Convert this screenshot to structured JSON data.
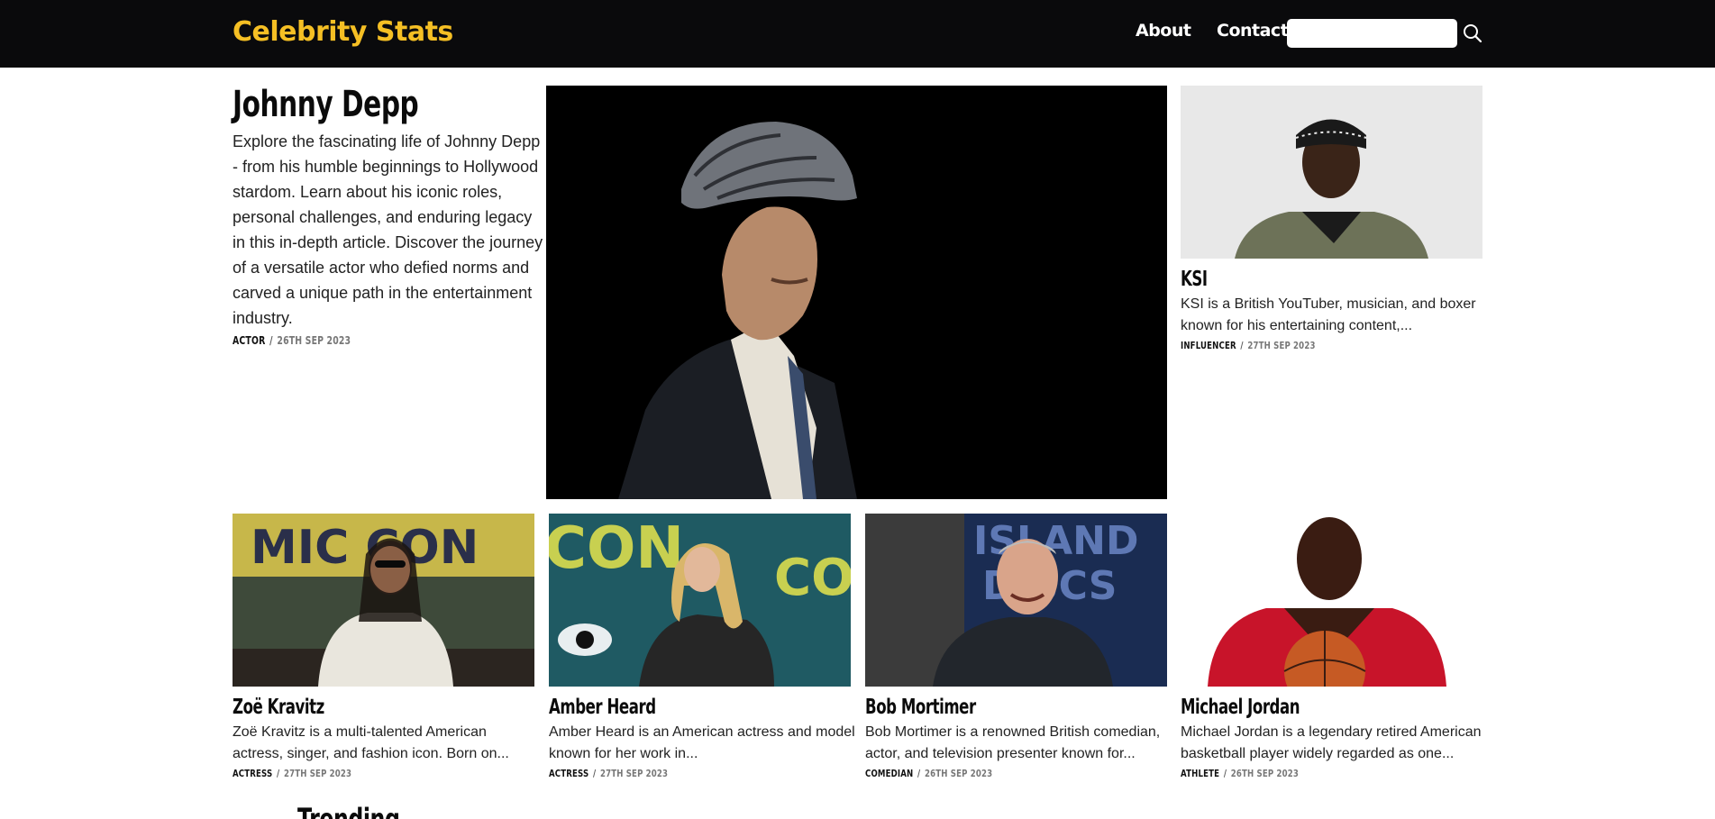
{
  "header": {
    "brand": "Celebrity Stats",
    "nav": {
      "about": "About",
      "contact": "Contact"
    },
    "search": {
      "value": "",
      "placeholder": ""
    },
    "brand_color": "#f5bf24",
    "background": "#0a0a0c"
  },
  "featured": {
    "name": "Johnny Depp",
    "description": "Explore the fascinating life of Johnny Depp - from his humble beginnings to Hollywood stardom. Learn about his iconic roles, personal challenges, and enduring legacy in this in-depth article. Discover the journey of a versatile actor who defied norms and carved a unique path in the entertainment industry.",
    "category": "ACTOR",
    "separator": "/",
    "date": "26TH SEP 2023"
  },
  "side_card": {
    "name": "KSI",
    "excerpt": "KSI is a British YouTuber, musician, and boxer known for his entertaining content,...",
    "category": "INFLUENCER",
    "separator": "/",
    "date": "27TH SEP 2023"
  },
  "cards": [
    {
      "name": "Zoë Kravitz",
      "excerpt": "Zoë Kravitz is a multi-talented American actress, singer, and fashion icon. Born on...",
      "category": "ACTRESS",
      "separator": "/",
      "date": "27TH SEP 2023"
    },
    {
      "name": "Amber Heard",
      "excerpt": "Amber Heard is an American actress and model known for her work in...",
      "category": "ACTRESS",
      "separator": "/",
      "date": "27TH SEP 2023"
    },
    {
      "name": "Bob Mortimer",
      "excerpt": "Bob Mortimer is a renowned British comedian, actor, and television presenter known for...",
      "category": "COMEDIAN",
      "separator": "/",
      "date": "26TH SEP 2023"
    },
    {
      "name": "Michael Jordan",
      "excerpt": "Michael Jordan is a legendary retired American basketball player widely regarded as one...",
      "category": "ATHLETE",
      "separator": "/",
      "date": "26TH SEP 2023"
    }
  ],
  "trending": {
    "heading": "Trending"
  }
}
